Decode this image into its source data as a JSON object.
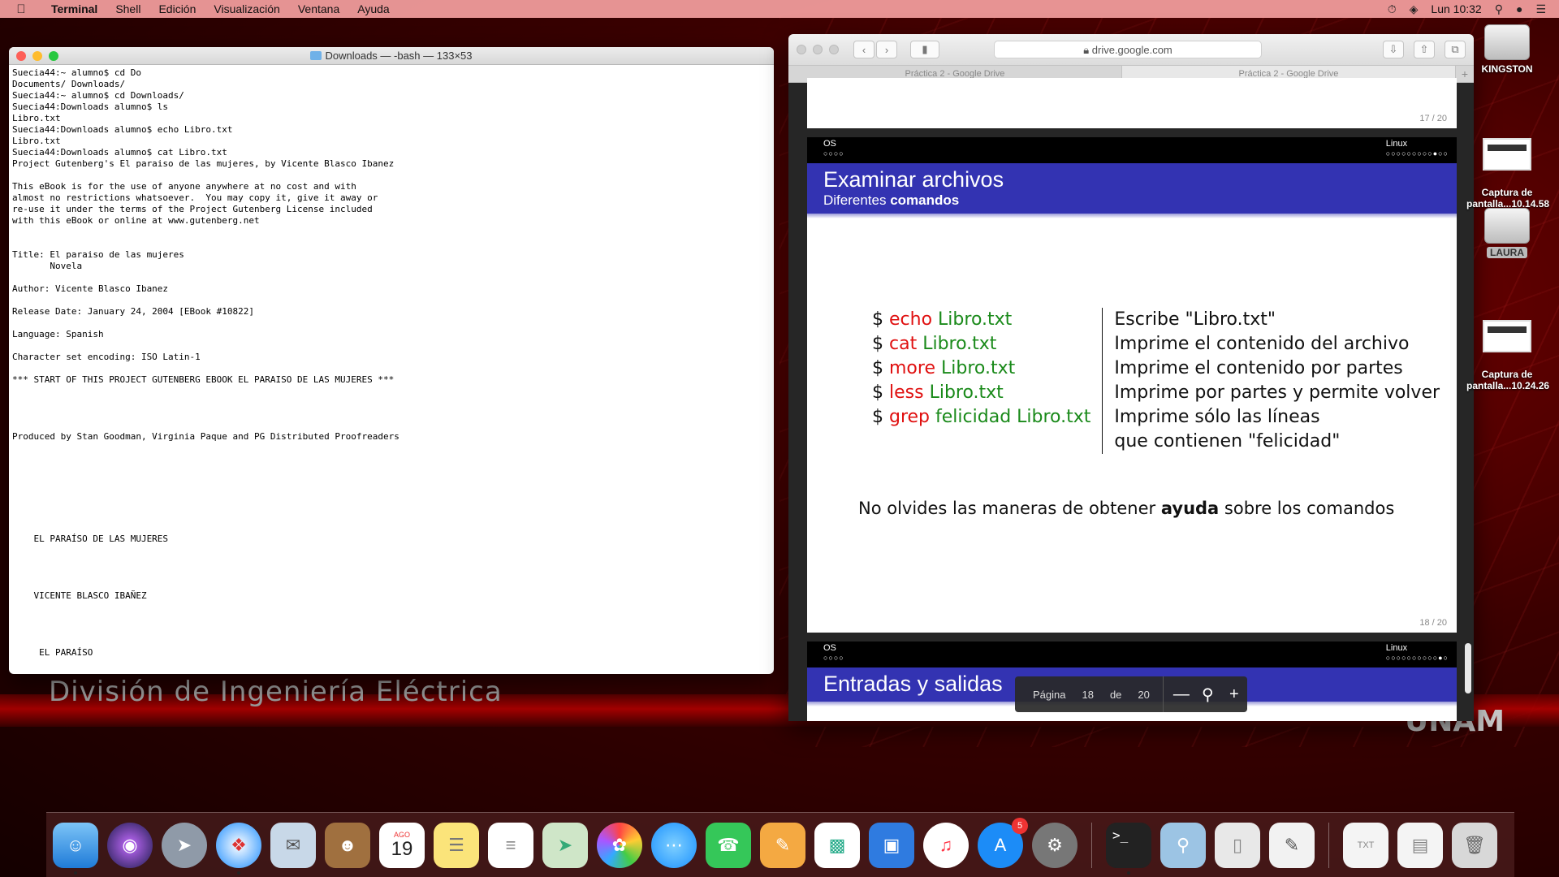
{
  "menubar": {
    "app_name": "Terminal",
    "items": [
      "Shell",
      "Edición",
      "Visualización",
      "Ventana",
      "Ayuda"
    ],
    "clock": "Lun 10:32"
  },
  "terminal": {
    "title": "Downloads — -bash — 133×53",
    "content": "Suecia44:~ alumno$ cd Do\nDocuments/ Downloads/\nSuecia44:~ alumno$ cd Downloads/\nSuecia44:Downloads alumno$ ls\nLibro.txt\nSuecia44:Downloads alumno$ echo Libro.txt\nLibro.txt\nSuecia44:Downloads alumno$ cat Libro.txt\nProject Gutenberg's El paraiso de las mujeres, by Vicente Blasco Ibanez\n\nThis eBook is for the use of anyone anywhere at no cost and with\nalmost no restrictions whatsoever.  You may copy it, give it away or\nre-use it under the terms of the Project Gutenberg License included\nwith this eBook or online at www.gutenberg.net\n\n\nTitle: El paraiso de las mujeres\n       Novela\n\nAuthor: Vicente Blasco Ibanez\n\nRelease Date: January 24, 2004 [EBook #10822]\n\nLanguage: Spanish\n\nCharacter set encoding: ISO Latin-1\n\n*** START OF THIS PROJECT GUTENBERG EBOOK EL PARAISO DE LAS MUJERES ***\n\n\n\n\nProduced by Stan Goodman, Virginia Paque and PG Distributed Proofreaders\n\n\n\n\n\n\n\n\n    EL PARAÍSO DE LAS MUJERES\n\n\n\n\n    VICENTE BLASCO IBAÑEZ\n\n\n\n\n     EL PARAÍSO"
  },
  "safari": {
    "url": "drive.google.com",
    "tabs": [
      "Práctica 2 - Google Drive",
      "Práctica 2 - Google Drive"
    ]
  },
  "pdf": {
    "page17_num": "17 / 20",
    "page18_num": "18 / 20",
    "header_left": "OS",
    "header_left_dots": "○○○○",
    "header_right": "Linux",
    "header_right_dots": "○○○○○○○○○●○○",
    "header_right_dots_next": "○○○○○○○○○○●○",
    "slide_title": "Examinar archivos",
    "slide_subtitle_plain": "Diferentes",
    "slide_subtitle_bold": "comandos",
    "commands": [
      {
        "dollar": "$",
        "cmd": "echo",
        "arg": "Libro.txt",
        "desc": "Escribe \"Libro.txt\""
      },
      {
        "dollar": "$",
        "cmd": "cat",
        "arg": "Libro.txt",
        "desc": "Imprime el contenido del archivo"
      },
      {
        "dollar": "$",
        "cmd": "more",
        "arg": "Libro.txt",
        "desc": "Imprime el contenido por partes"
      },
      {
        "dollar": "$",
        "cmd": "less",
        "arg": "Libro.txt",
        "desc": "Imprime por partes y permite volver"
      },
      {
        "dollar": "$",
        "cmd": "grep",
        "arg": "felicidad Libro.txt",
        "desc": "Imprime sólo las líneas"
      }
    ],
    "desc_extra": "que contienen \"felicidad\"",
    "help_pre": "No olvides las maneras de obtener",
    "help_bold": "ayuda",
    "help_post": "sobre los comandos",
    "next_title": "Entradas y salidas",
    "toolbar": {
      "page_label": "Página",
      "page": "18",
      "of_label": "de",
      "total": "20"
    }
  },
  "desktop": {
    "drive1": "KINGSTON",
    "shot1": "Captura de\npantalla...10.14.58",
    "drive2": "LAURA",
    "shot2": "Captura de\npantalla...10.24.26"
  },
  "wallpaper": {
    "left_text": "División de Ingeniería Eléctrica",
    "right_text": "UNAM"
  },
  "dock": {
    "calendar_month": "AGO",
    "calendar_day": "19",
    "appstore_badge": "5"
  },
  "colors": {
    "beamer_blue": "#3333b2",
    "cmd_red": "#e01010",
    "arg_green": "#1a8a1a"
  }
}
